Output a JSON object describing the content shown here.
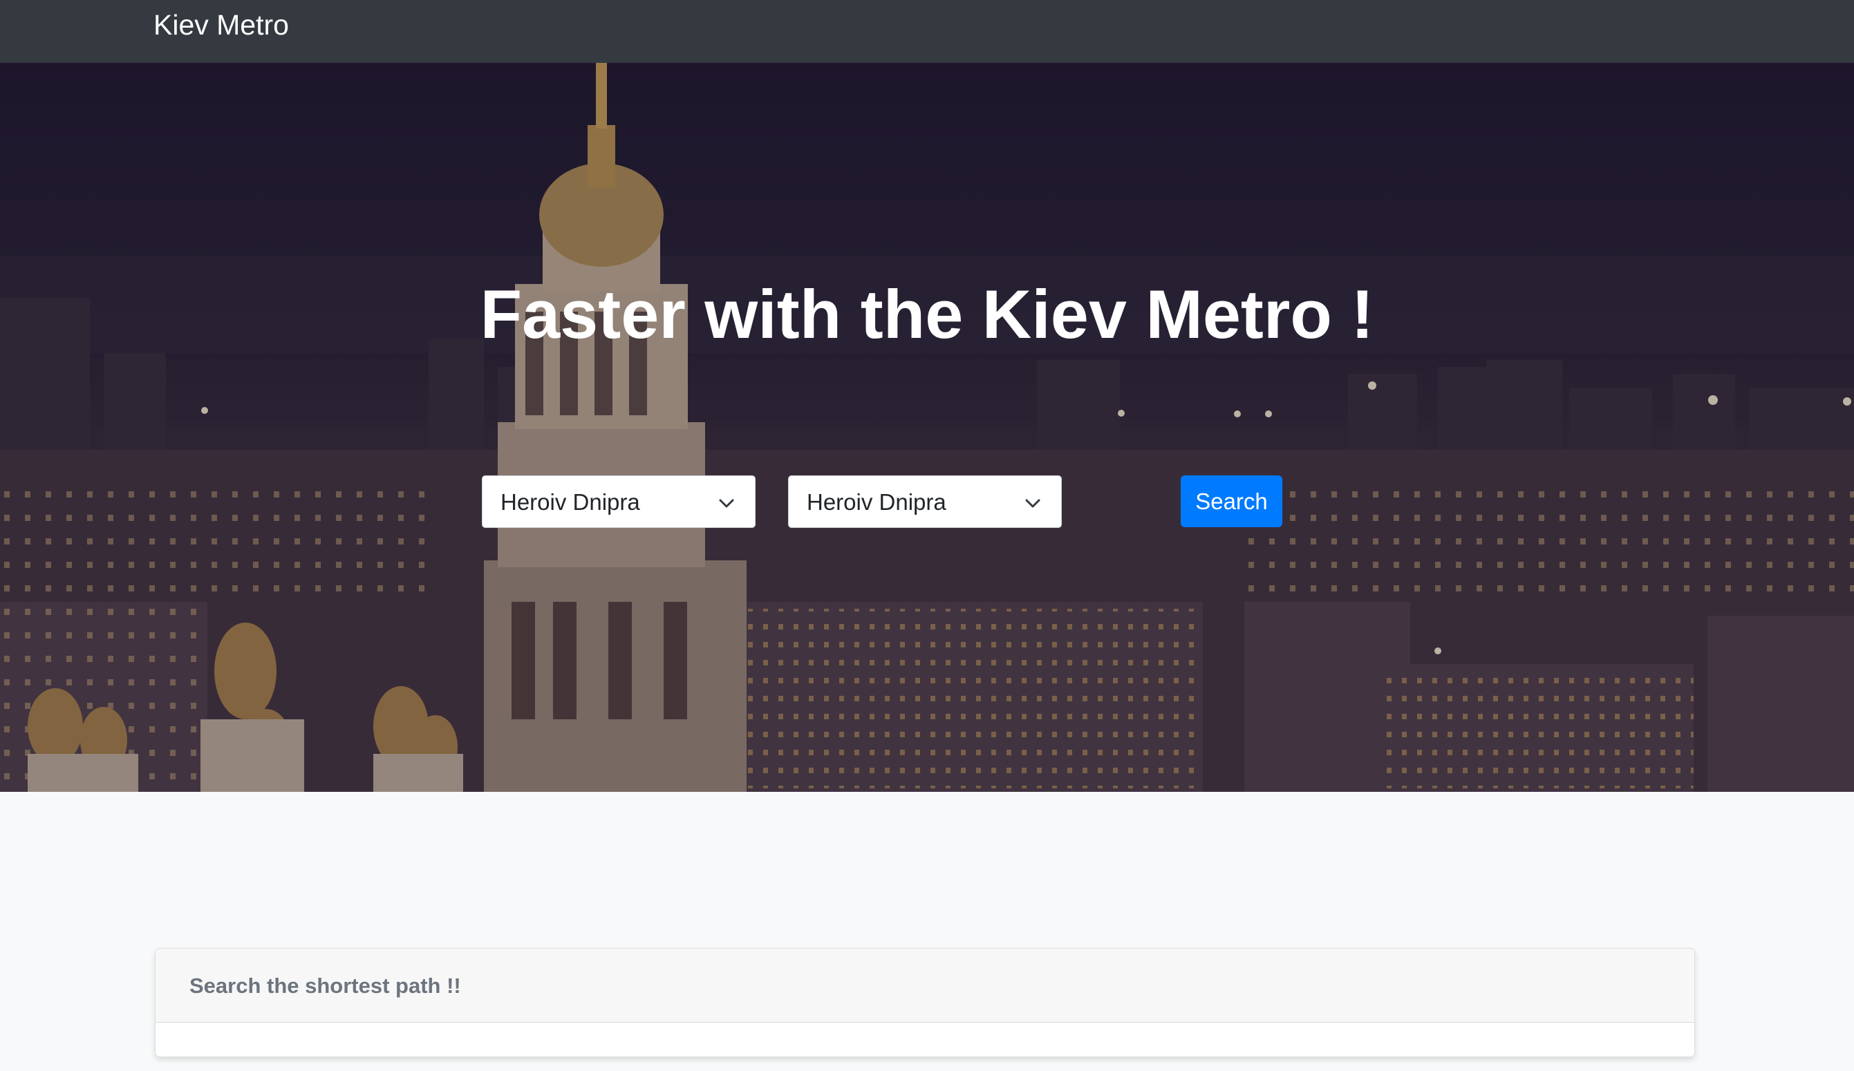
{
  "navbar": {
    "brand": "Kiev Metro"
  },
  "hero": {
    "title": "Faster with the Kiev Metro !",
    "from_select": {
      "selected": "Heroiv Dnipra"
    },
    "to_select": {
      "selected": "Heroiv Dnipra"
    },
    "search_label": "Search"
  },
  "result_card": {
    "header": "Search the shortest path !!"
  }
}
